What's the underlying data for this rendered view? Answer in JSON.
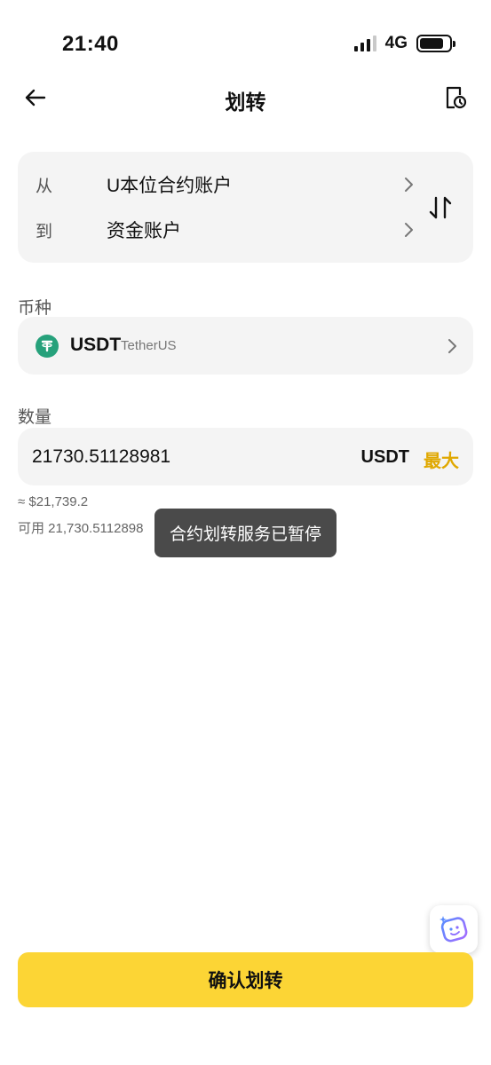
{
  "status_bar": {
    "time": "21:40",
    "network": "4G"
  },
  "header": {
    "title": "划转"
  },
  "transfer": {
    "from_label": "从",
    "from_value": "U本位合约账户",
    "to_label": "到",
    "to_value": "资金账户"
  },
  "coin": {
    "section_label": "币种",
    "symbol": "USDT",
    "name": "TetherUS",
    "icon_color": "#26a17b"
  },
  "amount": {
    "section_label": "数量",
    "value": "21730.51128981",
    "unit": "USDT",
    "max_label": "最大",
    "fiat_estimate": "≈ $21,739.2",
    "available": "可用 21,730.5112898"
  },
  "toast": {
    "message": "合约划转服务已暂停"
  },
  "confirm_button": {
    "label": "确认划转"
  },
  "colors": {
    "accent": "#fcd535",
    "max_text": "#e0a800",
    "card_bg": "#f4f4f4",
    "toast_bg": "#4a4a4a"
  }
}
